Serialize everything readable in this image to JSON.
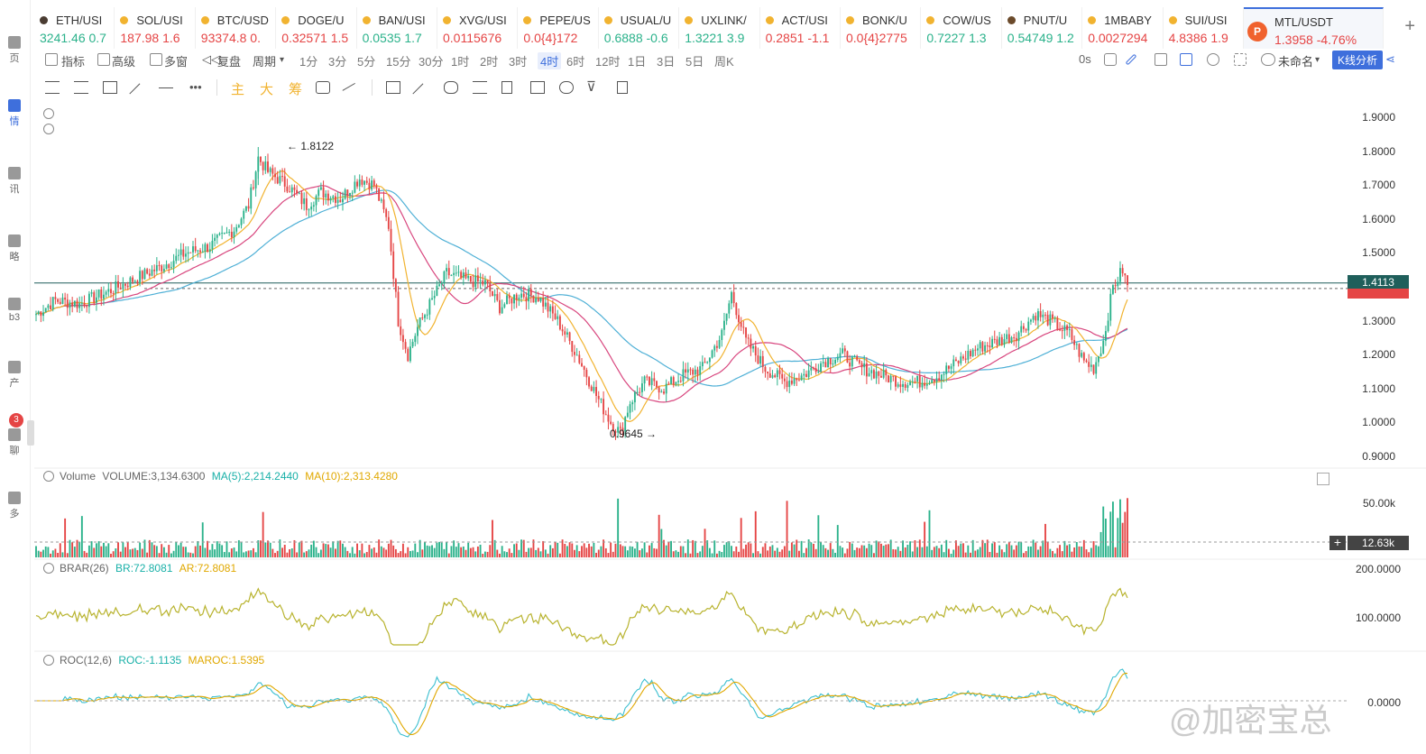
{
  "tickers": [
    {
      "symbol": "ETH/USDT",
      "display": "ETH/USI",
      "price": "3241.46",
      "change": "0.7",
      "dir": "up",
      "dot": "#4a3c32"
    },
    {
      "symbol": "SOL/USDT",
      "display": "SOL/USI",
      "price": "187.98",
      "change": "1.6",
      "dir": "dn",
      "dot": "#f1b330"
    },
    {
      "symbol": "BTC/USDT",
      "display": "BTC/USD",
      "price": "93374.8",
      "change": "0.",
      "dir": "dn",
      "dot": "#f1b330"
    },
    {
      "symbol": "DOGE/USDT",
      "display": "DOGE/U",
      "price": "0.32571",
      "change": "1.5",
      "dir": "dn",
      "dot": "#f1b330"
    },
    {
      "symbol": "BAN/USDT",
      "display": "BAN/USI",
      "price": "0.0535",
      "change": "1.7",
      "dir": "up",
      "dot": "#f1b330"
    },
    {
      "symbol": "XVG/USDT",
      "display": "XVG/USI",
      "price": "0.0115676",
      "change": "",
      "dir": "dn",
      "dot": "#f1b330"
    },
    {
      "symbol": "PEPE/USDT",
      "display": "PEPE/US",
      "price": "0.0{4}172",
      "change": "",
      "dir": "dn",
      "dot": "#f1b330"
    },
    {
      "symbol": "USUAL/USDT",
      "display": "USUAL/U",
      "price": "0.6888",
      "change": "-0.6",
      "dir": "up",
      "dot": "#f1b330"
    },
    {
      "symbol": "UXLINK/USDT",
      "display": "UXLINK/",
      "price": "1.3221",
      "change": "3.9",
      "dir": "up",
      "dot": "#f1b330"
    },
    {
      "symbol": "ACT/USDT",
      "display": "ACT/USI",
      "price": "0.2851",
      "change": "-1.1",
      "dir": "dn",
      "dot": "#f1b330"
    },
    {
      "symbol": "BONK/USDT",
      "display": "BONK/U",
      "price": "0.0{4}2775",
      "change": "",
      "dir": "dn",
      "dot": "#f1b330"
    },
    {
      "symbol": "COW/USDT",
      "display": "COW/US",
      "price": "0.7227",
      "change": "1.3",
      "dir": "up",
      "dot": "#f1b330"
    },
    {
      "symbol": "PNUT/USDT",
      "display": "PNUT/U",
      "price": "0.54749",
      "change": "1.2",
      "dir": "up",
      "dot": "#6b4a2b"
    },
    {
      "symbol": "1MBABY",
      "display": "1MBABY",
      "price": "0.0027294",
      "change": "",
      "dir": "dn",
      "dot": "#f1b330"
    },
    {
      "symbol": "SUI/USDT",
      "display": "SUI/USI",
      "price": "4.8386",
      "change": "1.9",
      "dir": "dn",
      "dot": "#f1b330"
    },
    {
      "symbol": "MTL/USDT",
      "display": "MTL/USDT",
      "price": "1.3958",
      "change": "-4.76%",
      "dir": "dn",
      "dot": "#f0622e",
      "active": true
    }
  ],
  "toolbar": {
    "indicator": "指标",
    "advanced": "高级",
    "multi": "多窗",
    "replay": "复盘",
    "period": "周期",
    "periods": [
      "1分",
      "3分",
      "5分",
      "15分",
      "30分",
      "1时",
      "2时",
      "3时",
      "4时",
      "6时",
      "12时",
      "1日",
      "3日",
      "5日",
      "周K"
    ],
    "active_period": "4时",
    "countdown": "0s",
    "layout_name": "未命名",
    "kline_analysis": "K线分析"
  },
  "drawing_chars": [
    "主",
    "大",
    "筹"
  ],
  "left_rail": [
    {
      "label": "页"
    },
    {
      "label": "情",
      "active": true
    },
    {
      "label": "讯"
    },
    {
      "label": "略"
    },
    {
      "label": "b3"
    },
    {
      "label": "产"
    },
    {
      "label": "聊"
    },
    {
      "label": "多"
    }
  ],
  "rail_badge": "3",
  "price_axis": [
    "1.9000",
    "1.8000",
    "1.7000",
    "1.6000",
    "1.5000",
    "1.3000",
    "1.2000",
    "1.1000",
    "1.0000",
    "0.9000"
  ],
  "current_price": "1.4113",
  "current_price_color": "#1f5f5b",
  "sub_price_color": "#e54545",
  "high_annotation": "1.8122",
  "low_annotation": "0.9645",
  "volume": {
    "label": "Volume",
    "value": "VOLUME:3,134.6300",
    "ma5": "MA(5):2,214.2440",
    "ma10": "MA(10):2,313.4280",
    "axis_top": "50.00k",
    "current": "12.63k"
  },
  "brar": {
    "label": "BRAR(26)",
    "br": "BR:72.8081",
    "ar": "AR:72.8081",
    "axis_top": "200.0000",
    "axis_mid": "100.0000"
  },
  "roc": {
    "label": "ROC(12,6)",
    "roc": "ROC:-1.1135",
    "maroc": "MAROC:1.5395",
    "axis": "0.0000"
  },
  "watermark": "@加密宝总",
  "chart_data": {
    "type": "line",
    "title": "MTL/USDT 4时",
    "series": [
      {
        "name": "price",
        "anchors": [
          [
            0,
            1.32
          ],
          [
            8,
            1.36
          ],
          [
            18,
            1.35
          ],
          [
            28,
            1.38
          ],
          [
            40,
            1.42
          ],
          [
            52,
            1.46
          ],
          [
            62,
            1.5
          ],
          [
            72,
            1.52
          ],
          [
            82,
            1.57
          ],
          [
            88,
            1.64
          ],
          [
            92,
            1.78
          ],
          [
            96,
            1.74
          ],
          [
            104,
            1.7
          ],
          [
            112,
            1.64
          ],
          [
            118,
            1.68
          ],
          [
            126,
            1.66
          ],
          [
            134,
            1.72
          ],
          [
            140,
            1.7
          ],
          [
            146,
            1.58
          ],
          [
            150,
            1.3
          ],
          [
            154,
            1.2
          ],
          [
            158,
            1.28
          ],
          [
            164,
            1.36
          ],
          [
            170,
            1.44
          ],
          [
            178,
            1.42
          ],
          [
            186,
            1.41
          ],
          [
            192,
            1.34
          ],
          [
            200,
            1.38
          ],
          [
            208,
            1.37
          ],
          [
            216,
            1.3
          ],
          [
            224,
            1.2
          ],
          [
            232,
            1.08
          ],
          [
            238,
            1.0
          ],
          [
            242,
            0.97
          ],
          [
            246,
            1.06
          ],
          [
            252,
            1.12
          ],
          [
            260,
            1.1
          ],
          [
            268,
            1.14
          ],
          [
            276,
            1.16
          ],
          [
            284,
            1.26
          ],
          [
            288,
            1.38
          ],
          [
            294,
            1.24
          ],
          [
            302,
            1.16
          ],
          [
            310,
            1.12
          ],
          [
            318,
            1.14
          ],
          [
            326,
            1.18
          ],
          [
            334,
            1.2
          ],
          [
            342,
            1.16
          ],
          [
            350,
            1.14
          ],
          [
            358,
            1.12
          ],
          [
            366,
            1.12
          ],
          [
            374,
            1.14
          ],
          [
            382,
            1.18
          ],
          [
            390,
            1.22
          ],
          [
            398,
            1.24
          ],
          [
            406,
            1.26
          ],
          [
            414,
            1.32
          ],
          [
            420,
            1.3
          ],
          [
            428,
            1.26
          ],
          [
            434,
            1.18
          ],
          [
            438,
            1.16
          ],
          [
            442,
            1.24
          ],
          [
            446,
            1.4
          ],
          [
            450,
            1.45
          ],
          [
            452,
            1.4
          ]
        ]
      }
    ],
    "ylim": [
      0.9,
      1.9
    ]
  }
}
